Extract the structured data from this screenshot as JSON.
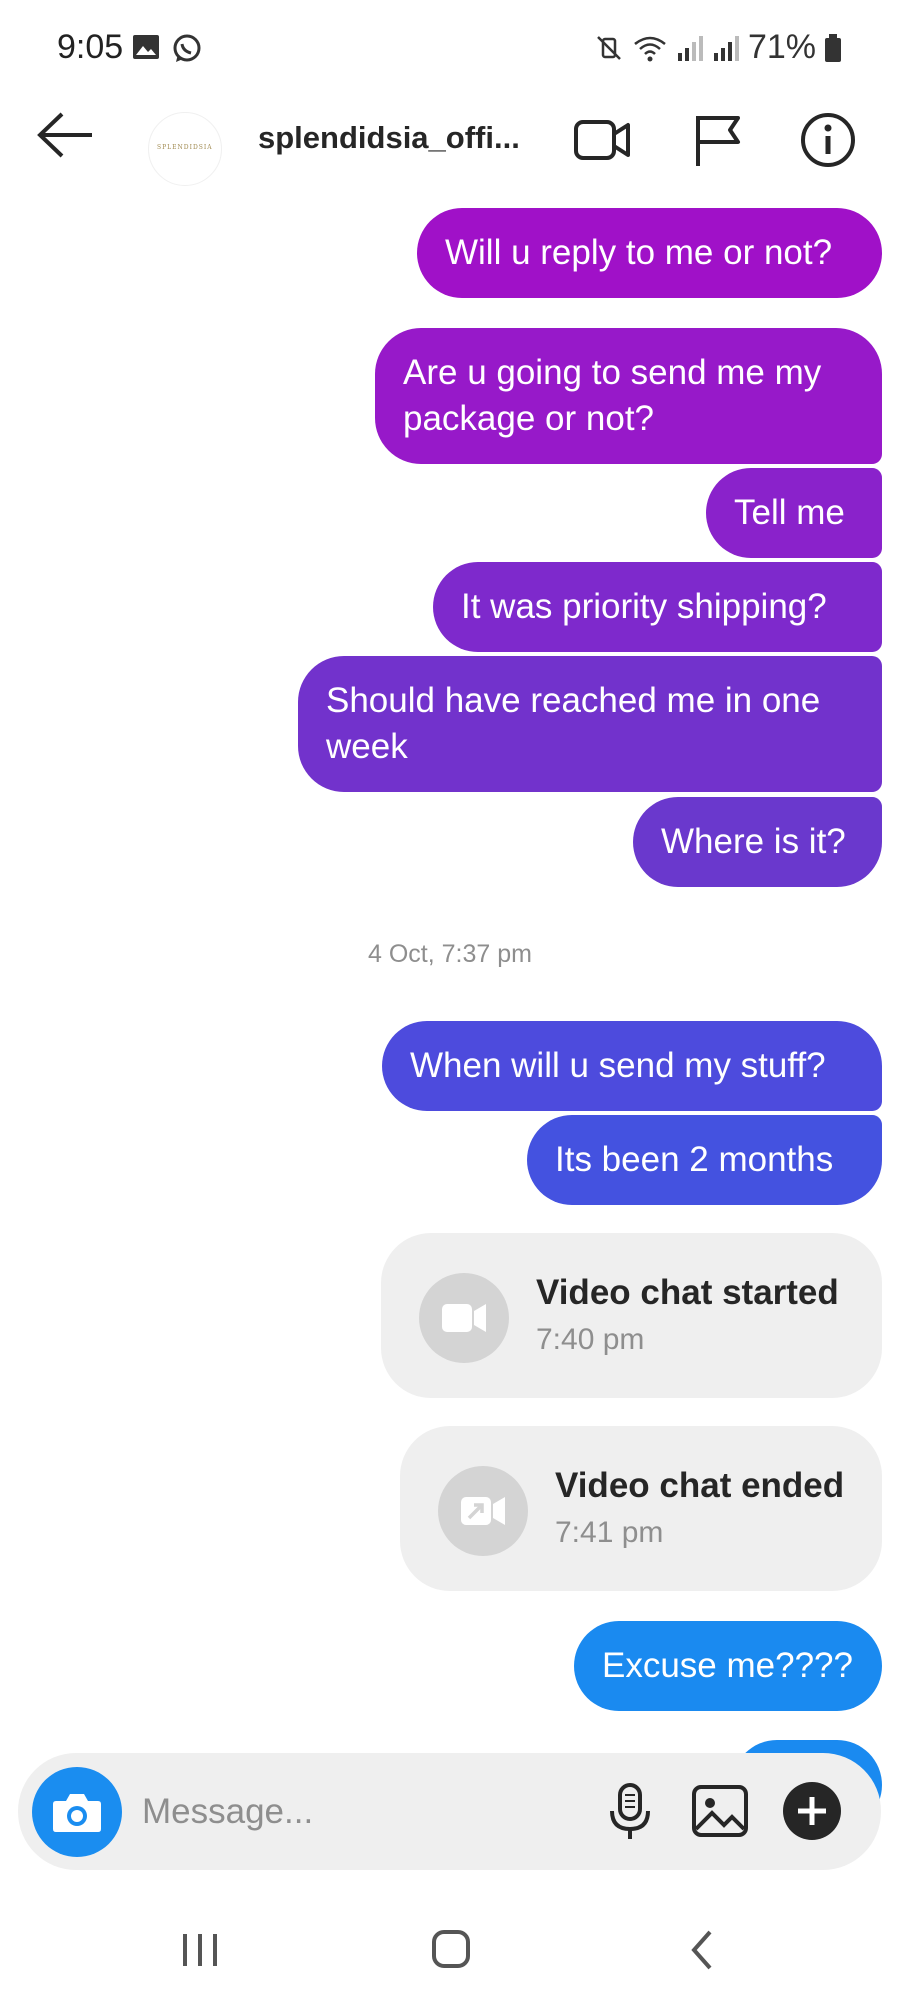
{
  "status_bar": {
    "time": "9:05",
    "battery": "71%"
  },
  "header": {
    "title": "splendidsia_offi...",
    "avatar_text": "SPLENDIDSIA"
  },
  "messages": [
    {
      "text": "Will u reply to me or not?",
      "color": "#a011c8"
    },
    {
      "text": "Are u going to send me my\npackage or not?",
      "color": "#9719c9"
    },
    {
      "text": "Tell me",
      "color": "#8a22cb"
    },
    {
      "text": "It was priority shipping?",
      "color": "#7e29cc"
    },
    {
      "text": "Should have reached me in one\nweek",
      "color": "#7232cc"
    },
    {
      "text": "Where is it?",
      "color": "#6a38cd"
    },
    {
      "text": "When will u send my stuff?",
      "color": "#4d4bdd"
    },
    {
      "text": "Its been 2 months",
      "color": "#4452e0"
    },
    {
      "text": "Excuse me????",
      "color": "#1a8af0"
    }
  ],
  "timestamp": "4 Oct, 7:37 pm",
  "calls": [
    {
      "title": "Video chat started",
      "time": "7:40 pm",
      "icon": "video-camera-icon"
    },
    {
      "title": "Video chat ended",
      "time": "7:41 pm",
      "icon": "video-ended-icon"
    }
  ],
  "composer": {
    "placeholder": "Message..."
  },
  "colors": {
    "camera_button": "#1a8df0",
    "composer_bg": "#efefef"
  }
}
